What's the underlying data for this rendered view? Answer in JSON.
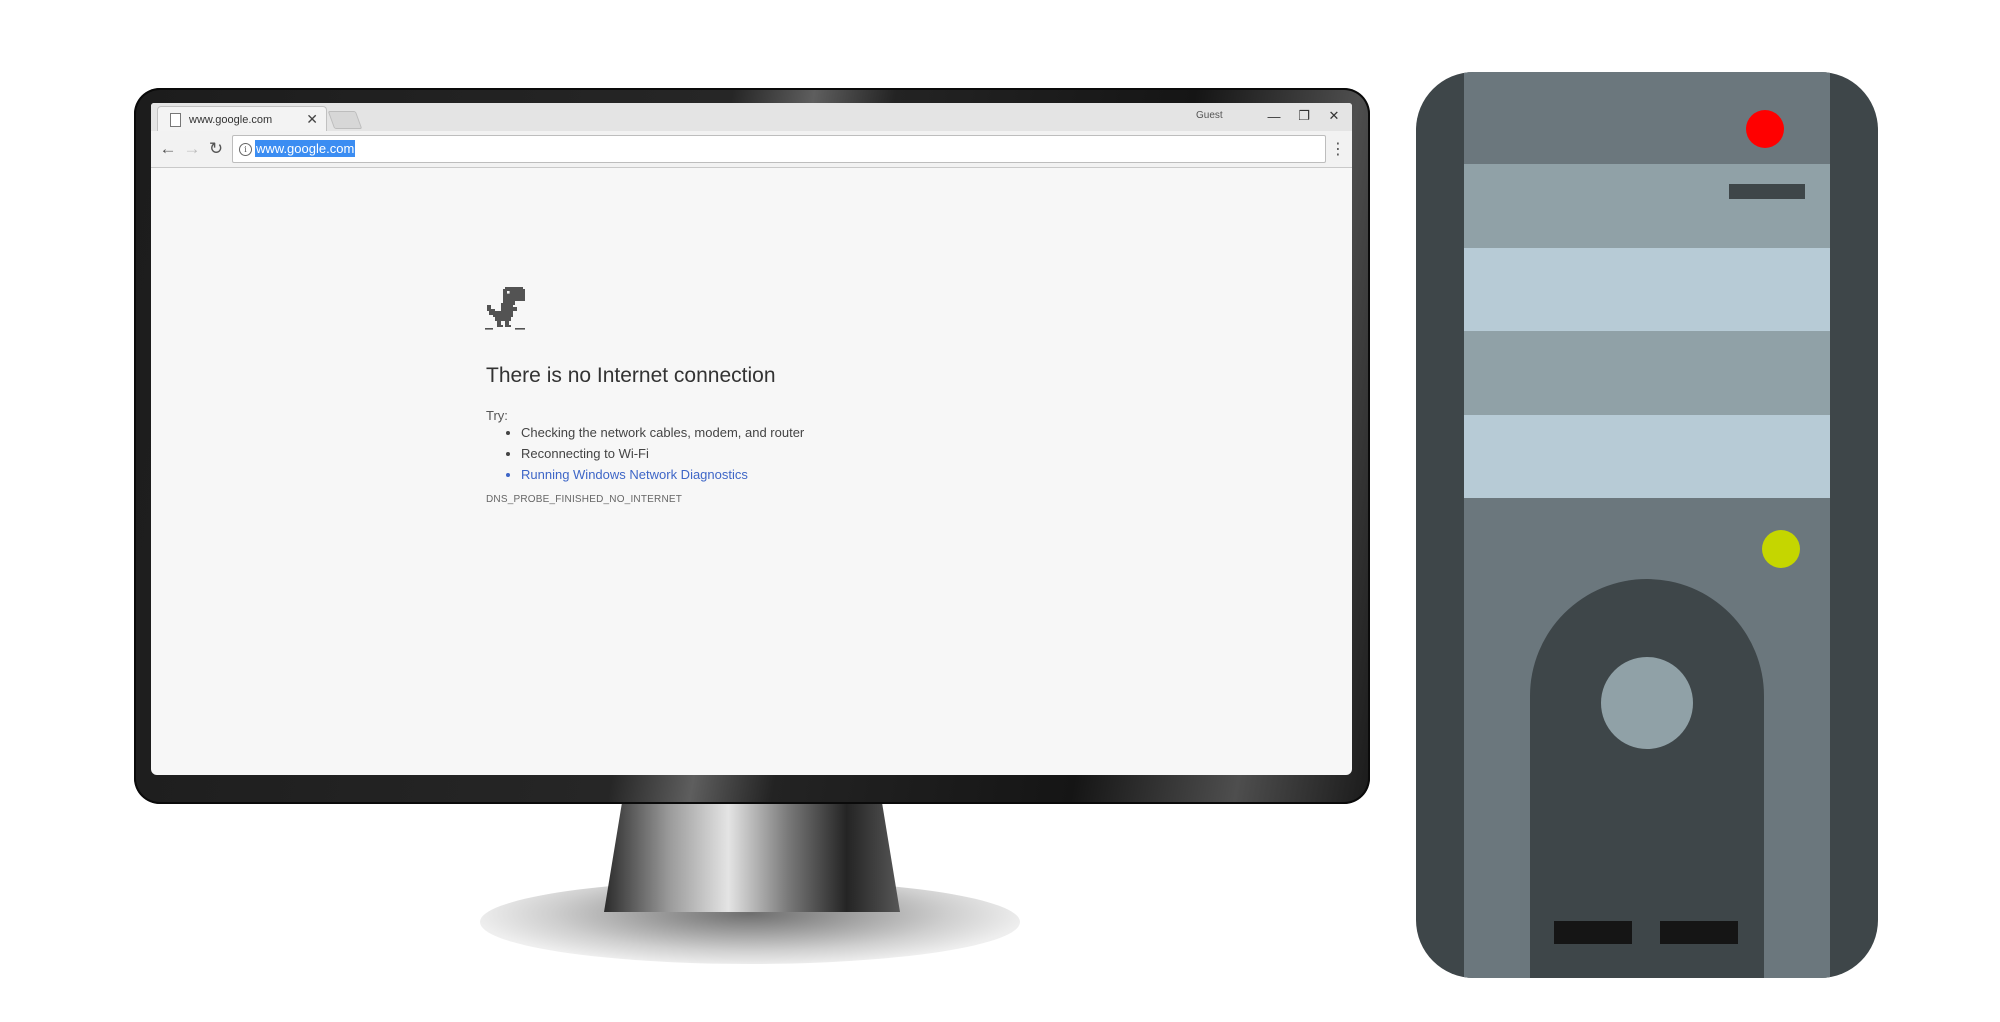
{
  "browser": {
    "tab": {
      "title": "www.google.com",
      "close_glyph": "✕",
      "icon": "page-icon"
    },
    "profile_label": "Guest",
    "window_controls": {
      "minimize": "—",
      "restore": "❐",
      "close": "✕"
    },
    "toolbar": {
      "back_glyph": "←",
      "forward_glyph": "→",
      "reload_glyph": "↻",
      "menu_glyph": "⋮",
      "site_info_glyph": "i"
    },
    "address_bar": {
      "value": "www.google.com",
      "selected": true
    }
  },
  "error_page": {
    "icon": "dinosaur-icon",
    "title": "There is no Internet connection",
    "try_label": "Try:",
    "suggestions": [
      "Checking the network cables, modem, and router",
      "Reconnecting to Wi-Fi",
      "Running Windows Network Diagnostics"
    ],
    "error_code": "DNS_PROBE_FINISHED_NO_INTERNET"
  },
  "colors": {
    "link": "#3e66c7",
    "selection": "#3b8df2",
    "tower_body": "#3e4649",
    "tower_face": "#6b777d",
    "bay_dark": "#90a1a7",
    "bay_light": "#b7cbd6",
    "power_led": "#ff0000",
    "status_led": "#c5d600"
  }
}
